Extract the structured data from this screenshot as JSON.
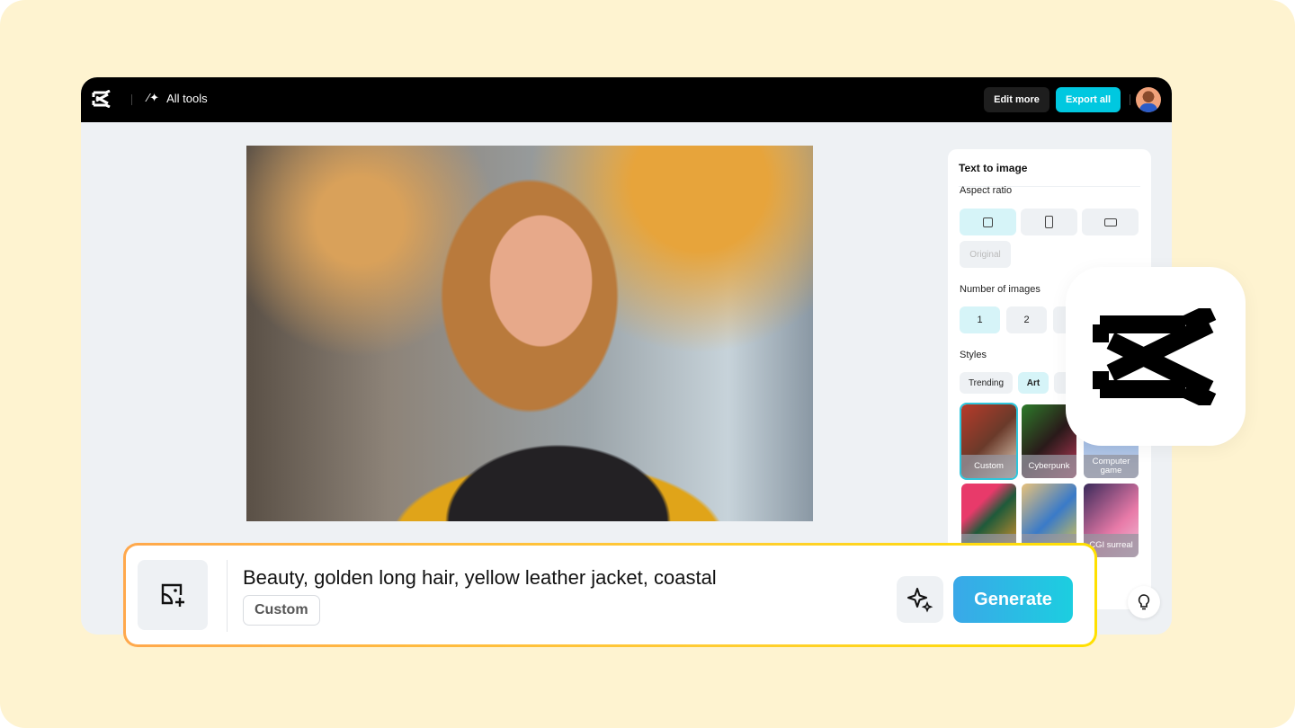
{
  "topbar": {
    "all_tools": "All tools",
    "edit_more": "Edit more",
    "export_all": "Export all"
  },
  "panel": {
    "title": "Text to image",
    "aspect_ratio_label": "Aspect ratio",
    "aspect_original": "Original",
    "num_images_label": "Number of images",
    "num_options": [
      "1",
      "2"
    ],
    "styles_label": "Styles",
    "style_tabs": [
      "Trending",
      "Art"
    ],
    "style_tiles": [
      "Custom",
      "Cyberpunk",
      "Computer game",
      "",
      "",
      "CGI surreal"
    ]
  },
  "prompt": {
    "text": "Beauty, golden long hair, yellow leather jacket, coastal",
    "style_tag": "Custom",
    "generate": "Generate"
  },
  "colors": {
    "accent": "#00c8e0",
    "background": "#fef3d0",
    "prompt_border": "#ffa84c"
  }
}
